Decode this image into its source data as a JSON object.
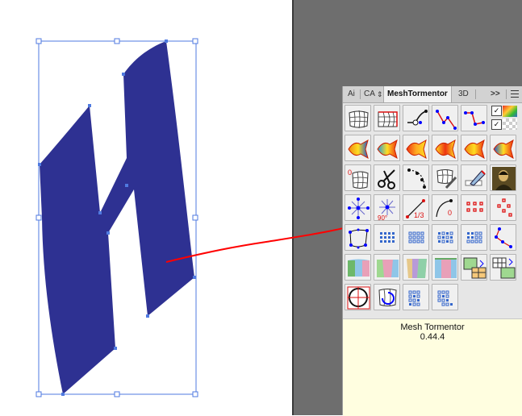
{
  "panel": {
    "tabs": [
      {
        "label": "Ai"
      },
      {
        "label": "CA"
      },
      {
        "label": "MeshTormentor"
      },
      {
        "label": "3D"
      }
    ],
    "overflow_label": ">>",
    "info_title": "Mesh Tormentor",
    "info_version": "0.44.4",
    "tools": [
      {
        "icon": "mesh-distort-icon"
      },
      {
        "icon": "mesh-warp-red-icon"
      },
      {
        "icon": "path-handles-icon"
      },
      {
        "icon": "node-edit-icon"
      },
      {
        "icon": "node-path-icon"
      },
      {
        "icon": "fish-gradient-1-icon"
      },
      {
        "icon": "fish-gradient-2-icon"
      },
      {
        "icon": "fish-gradient-3-icon"
      },
      {
        "icon": "fish-gradient-4-icon"
      },
      {
        "icon": "fish-gradient-5-icon"
      },
      {
        "icon": "fish-gradient-6-icon"
      },
      {
        "icon": "grid-zero-icon"
      },
      {
        "icon": "scissors-icon"
      },
      {
        "icon": "dashed-path-icon"
      },
      {
        "icon": "mesh-brush-icon"
      },
      {
        "icon": "pen-tool-icon"
      },
      {
        "icon": "mona-lisa-icon"
      },
      {
        "icon": "star-nodes-icon"
      },
      {
        "icon": "rotate-90-icon"
      },
      {
        "icon": "thirds-icon"
      },
      {
        "icon": "curve-zero-icon"
      },
      {
        "icon": "red-dot-grid-icon"
      },
      {
        "icon": "red-dot-cluster-icon"
      },
      {
        "icon": "bbox-nodes-icon"
      },
      {
        "icon": "blue-dot-grid-1-icon"
      },
      {
        "icon": "blue-dot-grid-2-icon"
      },
      {
        "icon": "blue-dot-grid-3-icon"
      },
      {
        "icon": "blue-dot-grid-4-icon"
      },
      {
        "icon": "red-path-nodes-icon"
      },
      {
        "icon": "color-patch-1-icon"
      },
      {
        "icon": "color-patch-2-icon"
      },
      {
        "icon": "color-patch-3-icon"
      },
      {
        "icon": "color-patch-4-icon"
      },
      {
        "icon": "split-grid-1-icon"
      },
      {
        "icon": "split-grid-2-icon"
      },
      {
        "icon": "target-circle-icon"
      },
      {
        "icon": "rotate-mesh-icon"
      },
      {
        "icon": "dot-pattern-1-icon"
      },
      {
        "icon": "dot-pattern-2-icon"
      }
    ]
  },
  "annotation_color": "#ff0000",
  "letter_fill": "#2e3192"
}
